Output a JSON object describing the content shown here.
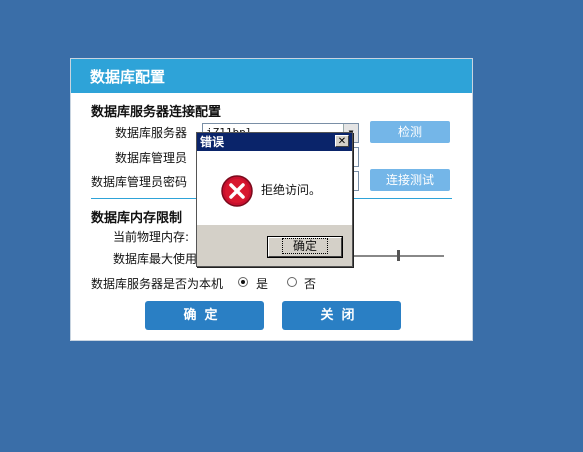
{
  "window": {
    "title": "数据库配置"
  },
  "server_section": {
    "heading": "数据库服务器连接配置",
    "server_label": "数据库服务器",
    "server_value": "iZ11bpl...",
    "admin_label": "数据库管理员",
    "password_label": "数据库管理员密码",
    "check_button": "检测",
    "connect_test_button": "连接测试"
  },
  "memory_section": {
    "heading": "数据库内存限制",
    "physical_label": "当前物理内存:",
    "max_usage_label": "数据库最大使用"
  },
  "local_question": {
    "label": "数据库服务器是否为本机",
    "yes": "是",
    "no": "否",
    "selected": "是"
  },
  "footer": {
    "ok_button": "确定",
    "close_button": "关闭"
  },
  "error_dialog": {
    "title": "错误",
    "close_glyph": "✕",
    "message": "拒绝访问。",
    "ok_button": "确定",
    "icon": "error-icon"
  }
}
